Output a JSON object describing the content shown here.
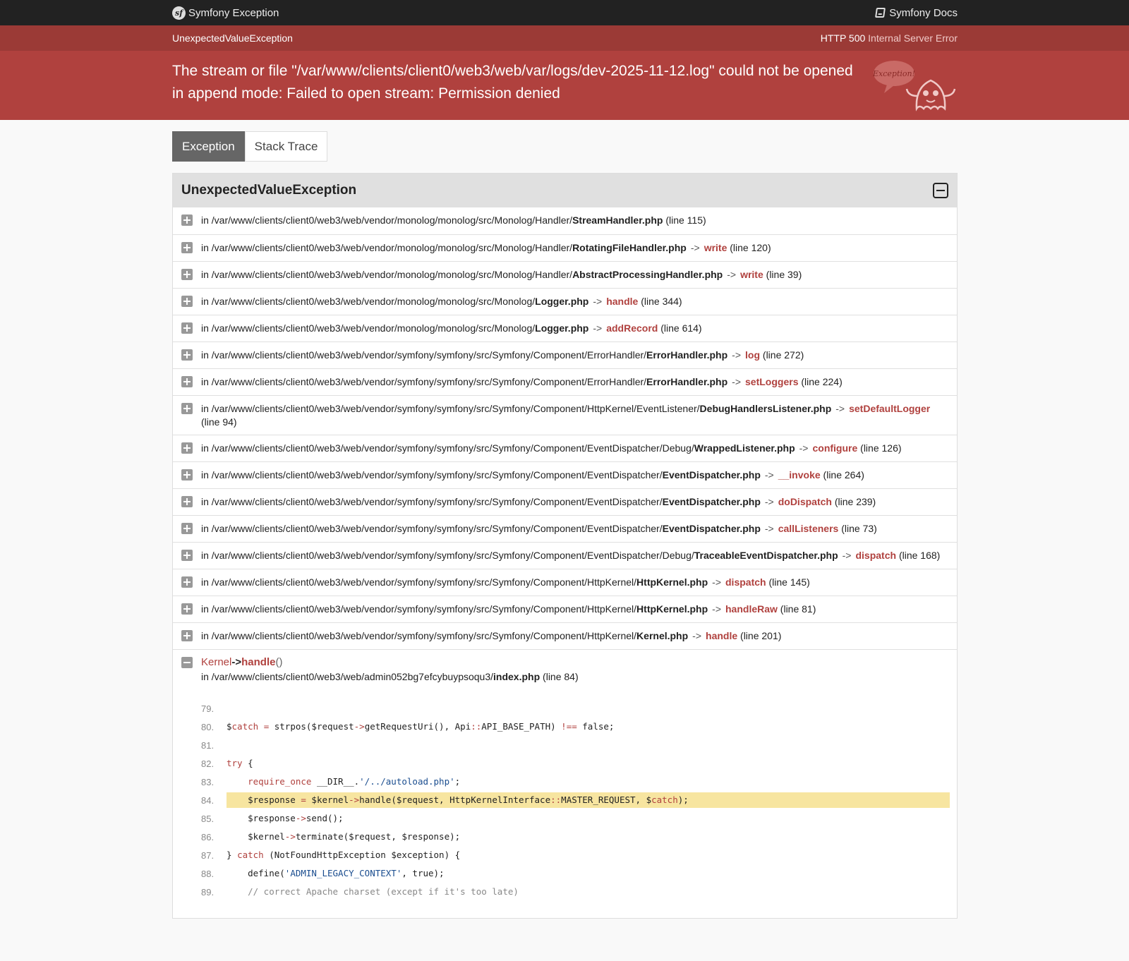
{
  "header": {
    "brand": "Symfony Exception",
    "docs": "Symfony Docs"
  },
  "summary": {
    "exception_class": "UnexpectedValueException",
    "status_code": "HTTP 500",
    "status_text": "Internal Server Error",
    "message": "The stream or file \"/var/www/clients/client0/web3/web/var/logs/dev-2025-11-12.log\" could not be opened in append mode: Failed to open stream: Permission denied",
    "ghost_label": "Exception!"
  },
  "tabs": [
    {
      "label": "Exception"
    },
    {
      "label": "Stack Trace"
    }
  ],
  "trace": {
    "title": "UnexpectedValueException",
    "lines": [
      {
        "prefix": "in ",
        "path": "/var/www/clients/client0/web3/web/vendor/monolog/monolog/src/Monolog/Handler/",
        "file": "StreamHandler.php",
        "arrow": "",
        "fn": "",
        "lineinfo": "(line 115)"
      },
      {
        "prefix": "in ",
        "path": "/var/www/clients/client0/web3/web/vendor/monolog/monolog/src/Monolog/Handler/",
        "file": "RotatingFileHandler.php",
        "arrow": "->",
        "fn": "write",
        "lineinfo": "(line 120)"
      },
      {
        "prefix": "in ",
        "path": "/var/www/clients/client0/web3/web/vendor/monolog/monolog/src/Monolog/Handler/",
        "file": "AbstractProcessingHandler.php",
        "arrow": "->",
        "fn": "write",
        "lineinfo": "(line 39)"
      },
      {
        "prefix": "in ",
        "path": "/var/www/clients/client0/web3/web/vendor/monolog/monolog/src/Monolog/",
        "file": "Logger.php",
        "arrow": "->",
        "fn": "handle",
        "lineinfo": "(line 344)"
      },
      {
        "prefix": "in ",
        "path": "/var/www/clients/client0/web3/web/vendor/monolog/monolog/src/Monolog/",
        "file": "Logger.php",
        "arrow": "->",
        "fn": "addRecord",
        "lineinfo": "(line 614)"
      },
      {
        "prefix": "in ",
        "path": "/var/www/clients/client0/web3/web/vendor/symfony/symfony/src/Symfony/Component/ErrorHandler/",
        "file": "ErrorHandler.php",
        "arrow": "->",
        "fn": "log",
        "lineinfo": "(line 272)"
      },
      {
        "prefix": "in ",
        "path": "/var/www/clients/client0/web3/web/vendor/symfony/symfony/src/Symfony/Component/ErrorHandler/",
        "file": "ErrorHandler.php",
        "arrow": "->",
        "fn": "setLoggers",
        "lineinfo": "(line 224)"
      },
      {
        "prefix": "in ",
        "path": "/var/www/clients/client0/web3/web/vendor/symfony/symfony/src/Symfony/Component/HttpKernel/EventListener/",
        "file": "DebugHandlersListener.php",
        "arrow": "->",
        "fn": "setDefaultLogger",
        "lineinfo": "(line 94)"
      },
      {
        "prefix": "in ",
        "path": "/var/www/clients/client0/web3/web/vendor/symfony/symfony/src/Symfony/Component/EventDispatcher/Debug/",
        "file": "WrappedListener.php",
        "arrow": "->",
        "fn": "configure",
        "lineinfo": "(line 126)"
      },
      {
        "prefix": "in ",
        "path": "/var/www/clients/client0/web3/web/vendor/symfony/symfony/src/Symfony/Component/EventDispatcher/",
        "file": "EventDispatcher.php",
        "arrow": "->",
        "fn": "__invoke",
        "lineinfo": "(line 264)"
      },
      {
        "prefix": "in ",
        "path": "/var/www/clients/client0/web3/web/vendor/symfony/symfony/src/Symfony/Component/EventDispatcher/",
        "file": "EventDispatcher.php",
        "arrow": "->",
        "fn": "doDispatch",
        "lineinfo": "(line 239)"
      },
      {
        "prefix": "in ",
        "path": "/var/www/clients/client0/web3/web/vendor/symfony/symfony/src/Symfony/Component/EventDispatcher/",
        "file": "EventDispatcher.php",
        "arrow": "->",
        "fn": "callListeners",
        "lineinfo": "(line 73)"
      },
      {
        "prefix": "in ",
        "path": "/var/www/clients/client0/web3/web/vendor/symfony/symfony/src/Symfony/Component/EventDispatcher/Debug/",
        "file": "TraceableEventDispatcher.php",
        "arrow": "->",
        "fn": "dispatch",
        "lineinfo": "(line 168)"
      },
      {
        "prefix": "in ",
        "path": "/var/www/clients/client0/web3/web/vendor/symfony/symfony/src/Symfony/Component/HttpKernel/",
        "file": "HttpKernel.php",
        "arrow": "->",
        "fn": "dispatch",
        "lineinfo": "(line 145)"
      },
      {
        "prefix": "in ",
        "path": "/var/www/clients/client0/web3/web/vendor/symfony/symfony/src/Symfony/Component/HttpKernel/",
        "file": "HttpKernel.php",
        "arrow": "->",
        "fn": "handleRaw",
        "lineinfo": "(line 81)"
      },
      {
        "prefix": "in ",
        "path": "/var/www/clients/client0/web3/web/vendor/symfony/symfony/src/Symfony/Component/HttpKernel/",
        "file": "Kernel.php",
        "arrow": "->",
        "fn": "handle",
        "lineinfo": "(line 201)"
      }
    ],
    "expanded": {
      "class": "Kernel",
      "arrow": "->",
      "fn": "handle",
      "paren": "()",
      "prefix": "in ",
      "path": "/var/www/clients/client0/web3/web/admin052bg7efcybuypsoqu3/",
      "file": "index.php",
      "lineinfo": "(line 84)"
    },
    "code": [
      {
        "num": "79.",
        "src": ""
      },
      {
        "num": "80.",
        "src": "$catch = strpos($request->getRequestUri(), Api::API_BASE_PATH) !== false;"
      },
      {
        "num": "81.",
        "src": ""
      },
      {
        "num": "82.",
        "src": "try {"
      },
      {
        "num": "83.",
        "src": "    require_once __DIR__.'/../autoload.php';"
      },
      {
        "num": "84.",
        "src": "    $response = $kernel->handle($request, HttpKernelInterface::MASTER_REQUEST, $catch);",
        "highlight": true
      },
      {
        "num": "85.",
        "src": "    $response->send();"
      },
      {
        "num": "86.",
        "src": "    $kernel->terminate($request, $response);"
      },
      {
        "num": "87.",
        "src": "} catch (NotFoundHttpException $exception) {"
      },
      {
        "num": "88.",
        "src": "    define('ADMIN_LEGACY_CONTEXT', true);"
      },
      {
        "num": "89.",
        "src": "    // correct Apache charset (except if it's too late)"
      }
    ]
  },
  "colors": {
    "topbar": "#222222",
    "summary_top": "#9b3a36",
    "summary_main": "#b0413e",
    "function": "#b0413e",
    "highlight": "#f7e5a0"
  }
}
